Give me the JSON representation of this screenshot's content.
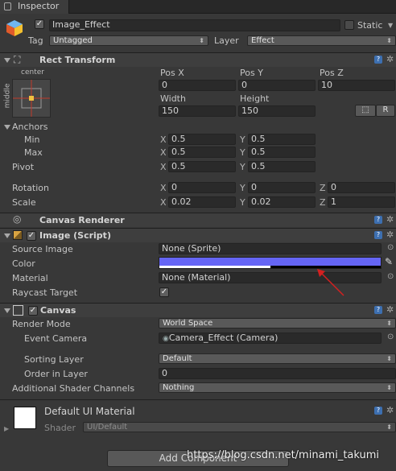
{
  "tab": {
    "title": "Inspector"
  },
  "object": {
    "name": "Image_Effect",
    "static_label": "Static",
    "tag_label": "Tag",
    "tag_value": "Untagged",
    "layer_label": "Layer",
    "layer_value": "Effect"
  },
  "rect_transform": {
    "title": "Rect Transform",
    "anchor_h": "center",
    "anchor_v": "middle",
    "posx_label": "Pos X",
    "posy_label": "Pos Y",
    "posz_label": "Pos Z",
    "posx": "0",
    "posy": "0",
    "posz": "10",
    "width_label": "Width",
    "height_label": "Height",
    "width": "150",
    "height": "150",
    "blueprint_btn": "⬚",
    "raw_btn": "R",
    "anchors_label": "Anchors",
    "min_label": "Min",
    "max_label": "Max",
    "min_x": "0.5",
    "min_y": "0.5",
    "max_x": "0.5",
    "max_y": "0.5",
    "pivot_label": "Pivot",
    "pivot_x": "0.5",
    "pivot_y": "0.5",
    "rotation_label": "Rotation",
    "rot_x": "0",
    "rot_y": "0",
    "rot_z": "0",
    "scale_label": "Scale",
    "scale_x": "0.02",
    "scale_y": "0.02",
    "scale_z": "1",
    "x": "X",
    "y": "Y",
    "z": "Z"
  },
  "canvas_renderer": {
    "title": "Canvas Renderer"
  },
  "image_script": {
    "title": "Image (Script)",
    "source_label": "Source Image",
    "source_value": "None (Sprite)",
    "color_label": "Color",
    "color_value": "#6565f5",
    "color_alpha": 0.5,
    "material_label": "Material",
    "material_value": "None (Material)",
    "raycast_label": "Raycast Target"
  },
  "canvas": {
    "title": "Canvas",
    "render_mode_label": "Render Mode",
    "render_mode_value": "World Space",
    "event_camera_label": "Event Camera",
    "event_camera_value": "Camera_Effect (Camera)",
    "sorting_layer_label": "Sorting Layer",
    "sorting_layer_value": "Default",
    "order_label": "Order in Layer",
    "order_value": "0",
    "shader_channels_label": "Additional Shader Channels",
    "shader_channels_value": "Nothing"
  },
  "material": {
    "name": "Default UI Material",
    "shader_label": "Shader",
    "shader_value": "UI/Default"
  },
  "add_component": "Add Component",
  "watermark": "https://blog.csdn.net/minami_takumi",
  "colors": {
    "accent": "#6565f5",
    "annotation_arrow": "#d42020"
  }
}
